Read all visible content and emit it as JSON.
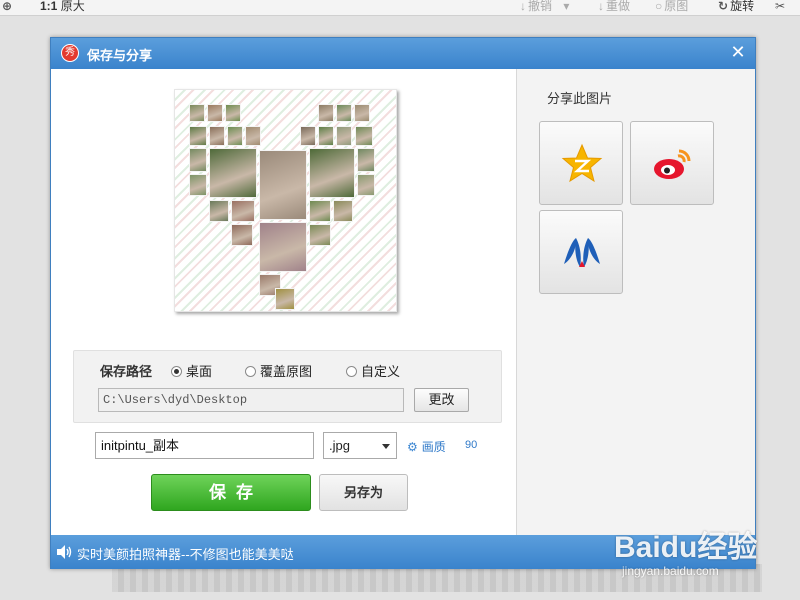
{
  "toolbar": {
    "zoom_icon": "zoom-in-icon",
    "ratio_label": "1:1",
    "original_label": "原大",
    "undo_label": "撤销",
    "redo_label": "重做",
    "reset_label": "原图",
    "rotate_label": "旋转"
  },
  "dialog": {
    "title": "保存与分享",
    "close_icon": "close-icon",
    "preview_image": "heart-shaped photo collage"
  },
  "save_path": {
    "label": "保存路径",
    "options": [
      {
        "label": "桌面",
        "selected": true
      },
      {
        "label": "覆盖原图",
        "selected": false
      },
      {
        "label": "自定义",
        "selected": false
      }
    ],
    "path_value": "C:\\Users\\dyd\\Desktop",
    "change_button": "更改"
  },
  "file": {
    "name_value": "initpintu_副本",
    "extension": ".jpg",
    "quality_label": "画质",
    "quality_value": "90"
  },
  "actions": {
    "save": "保存",
    "save_as": "另存为"
  },
  "share": {
    "title": "分享此图片",
    "targets": [
      {
        "name": "qzone",
        "icon": "qzone-star-icon",
        "color": "#f7b500"
      },
      {
        "name": "weibo",
        "icon": "weibo-icon",
        "color": "#e6162d"
      },
      {
        "name": "renren",
        "icon": "renren-icon",
        "color": "#1f5fb8"
      }
    ]
  },
  "footer": {
    "speaker_icon": "speaker-icon",
    "text": "实时美颜拍照神器--不修图也能美美哒"
  },
  "watermark": {
    "main": "Baidu经验",
    "sub": "jingyan.baidu.com"
  },
  "colors": {
    "title_bar": "#3a83cc",
    "save_green": "#2fa61f",
    "link_blue": "#2f79c8"
  }
}
